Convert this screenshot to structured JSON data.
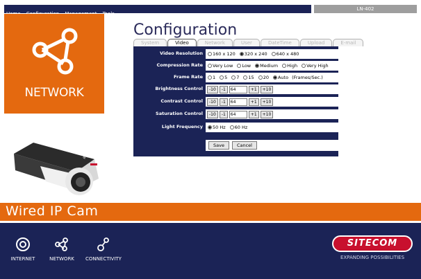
{
  "nav": {
    "links": [
      "Home",
      "Configuration",
      "Management",
      "Tools"
    ],
    "model": "LN-402"
  },
  "left_panel": {
    "title": "NETWORK"
  },
  "product": {
    "name": "Wired IP Cam",
    "camera_label": "IP CAM"
  },
  "config": {
    "title": "Configuration",
    "tabs": [
      "System",
      "Video",
      "Network",
      "User",
      "DateTime",
      "Upload",
      "E-mail"
    ],
    "active_tab": "Video",
    "video_resolution": {
      "label": "Video Resolution",
      "options": [
        "160 x 120",
        "320 x 240",
        "640 x 480"
      ],
      "selected": "320 x 240"
    },
    "compression_rate": {
      "label": "Compression Rate",
      "options": [
        "Very Low",
        "Low",
        "Medium",
        "High",
        "Very High"
      ],
      "selected": "Medium"
    },
    "frame_rate": {
      "label": "Frame Rate",
      "options": [
        "1",
        "5",
        "7",
        "15",
        "20",
        "Auto"
      ],
      "selected": "Auto",
      "unit": "(Frames/Sec.)"
    },
    "brightness": {
      "label": "Brightness Control",
      "dec10": "-10",
      "dec1": "-1",
      "value": "64",
      "inc1": "+1",
      "inc10": "+10"
    },
    "contrast": {
      "label": "Contrast Control",
      "dec10": "-10",
      "dec1": "-1",
      "value": "64",
      "inc1": "+1",
      "inc10": "+10"
    },
    "saturation": {
      "label": "Saturation Control",
      "dec10": "-10",
      "dec1": "-1",
      "value": "64",
      "inc1": "+1",
      "inc10": "+10"
    },
    "light_frequency": {
      "label": "Light Frequency",
      "options": [
        "50 Hz",
        "60 Hz"
      ],
      "selected": "50 Hz"
    },
    "save_label": "Save",
    "cancel_label": "Cancel"
  },
  "footer": {
    "icons": [
      {
        "label": "INTERNET",
        "icon": "internet-icon"
      },
      {
        "label": "NETWORK",
        "icon": "network-icon"
      },
      {
        "label": "CONNECTIVITY",
        "icon": "connectivity-icon"
      }
    ],
    "brand": "SITECOM",
    "tagline": "EXPANDING POSSIBILITIES"
  },
  "colors": {
    "navy": "#1b2356",
    "orange": "#e4690f",
    "brand_red": "#c8102e"
  }
}
